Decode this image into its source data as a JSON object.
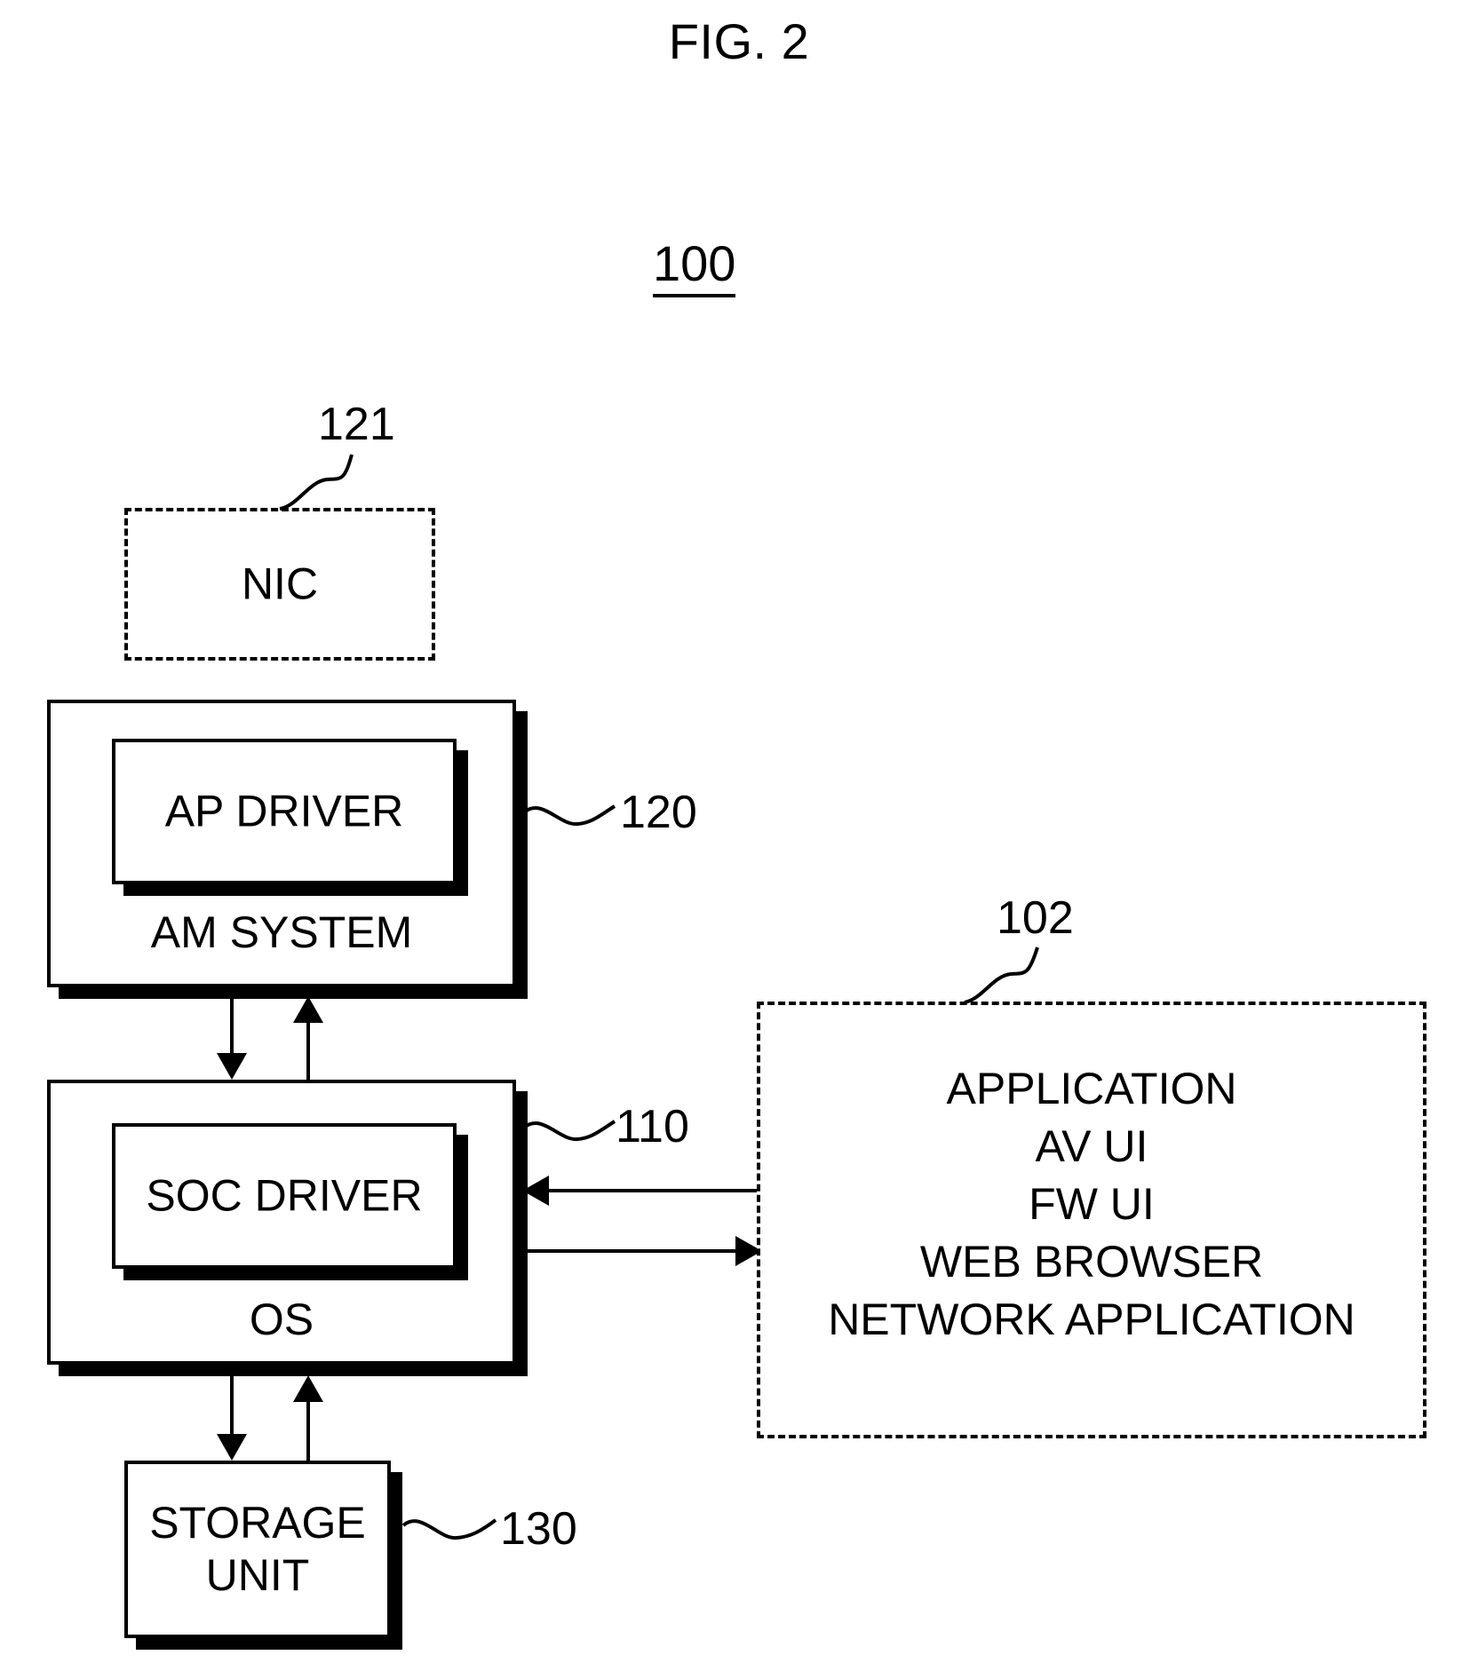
{
  "figure": {
    "title": "FIG. 2",
    "system_ref": "100"
  },
  "nodes": {
    "nic": {
      "label": "NIC",
      "ref": "121",
      "style": "dashed"
    },
    "am_system": {
      "label": "AM SYSTEM",
      "ref": "120",
      "inner": {
        "label": "AP DRIVER"
      }
    },
    "os": {
      "label": "OS",
      "ref": "110",
      "inner": {
        "label": "SOC DRIVER"
      }
    },
    "storage_unit": {
      "label_line1": "STORAGE",
      "label_line2": "UNIT",
      "ref": "130"
    },
    "application": {
      "ref": "102",
      "style": "dashed",
      "lines": [
        "APPLICATION",
        "AV UI",
        "FW UI",
        "WEB BROWSER",
        "NETWORK APPLICATION"
      ]
    }
  },
  "colors": {
    "stroke": "#000000",
    "fill": "#ffffff",
    "shadow": "#000000"
  }
}
